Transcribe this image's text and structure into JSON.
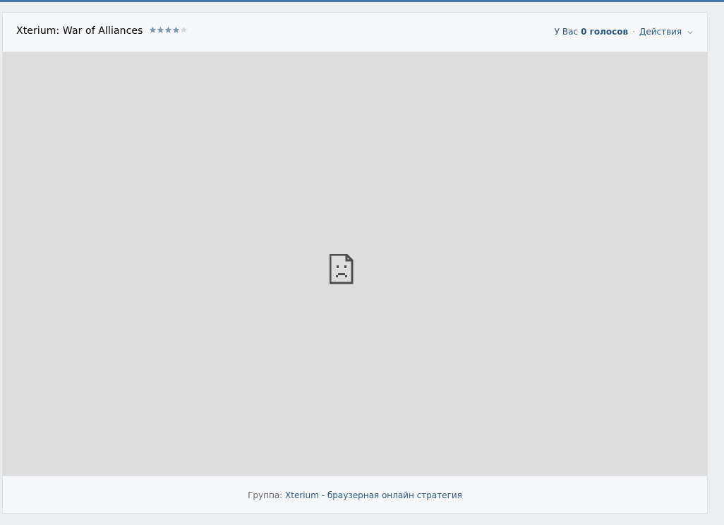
{
  "app": {
    "title": "Xterium: War of Alliances",
    "rating": {
      "value": 4,
      "max": 5,
      "filled_color": "#7e97b3",
      "empty_color": "#d3d9de"
    }
  },
  "header": {
    "votes_prefix": "У Вас",
    "votes_count": "0 голосов",
    "separator": "·",
    "actions_label": "Действия",
    "actions_icon": "chevron-down-icon"
  },
  "frame": {
    "state_icon": "sad-file-icon",
    "background": "#dddddd"
  },
  "footer": {
    "group_label": "Группа:",
    "group_link": "Xterium - браузерная онлайн стратегия"
  },
  "colors": {
    "accent": "#4a76a8",
    "link": "#2a5885"
  }
}
